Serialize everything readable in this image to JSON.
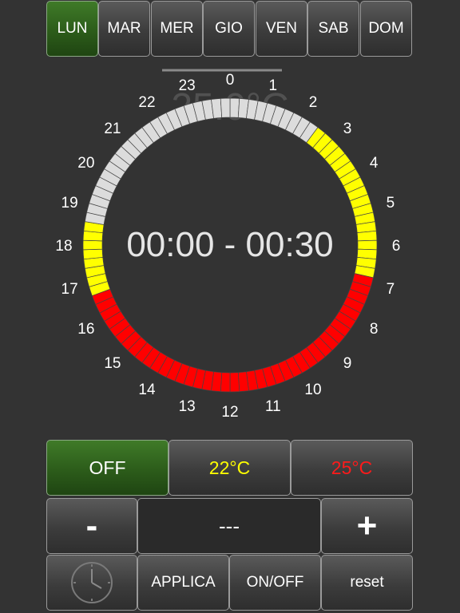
{
  "days": [
    {
      "label": "LUN",
      "active": true
    },
    {
      "label": "MAR",
      "active": false
    },
    {
      "label": "MER",
      "active": false
    },
    {
      "label": "GIO",
      "active": false
    },
    {
      "label": "VEN",
      "active": false
    },
    {
      "label": "SAB",
      "active": false
    },
    {
      "label": "DOM",
      "active": false
    }
  ],
  "dial": {
    "time_range": "00:00 - 00:30",
    "ghost_temp": "25.0°C",
    "hour_labels": [
      "0",
      "1",
      "2",
      "3",
      "4",
      "5",
      "6",
      "7",
      "8",
      "9",
      "10",
      "11",
      "12",
      "13",
      "14",
      "15",
      "16",
      "17",
      "18",
      "19",
      "20",
      "21",
      "22",
      "23"
    ],
    "segments": [
      "gray",
      "gray",
      "gray",
      "gray",
      "gray",
      "gray",
      "gray",
      "gray",
      "gray",
      "gray",
      "yellow",
      "yellow",
      "yellow",
      "yellow",
      "yellow",
      "yellow",
      "yellow",
      "yellow",
      "yellow",
      "yellow",
      "yellow",
      "yellow",
      "yellow",
      "yellow",
      "yellow",
      "yellow",
      "yellow",
      "yellow",
      "red",
      "red",
      "red",
      "red",
      "red",
      "red",
      "red",
      "red",
      "red",
      "red",
      "red",
      "red",
      "red",
      "red",
      "red",
      "red",
      "red",
      "red",
      "red",
      "red",
      "red",
      "red",
      "red",
      "red",
      "red",
      "red",
      "red",
      "red",
      "red",
      "red",
      "red",
      "red",
      "red",
      "red",
      "red",
      "red",
      "red",
      "red",
      "red",
      "red",
      "yellow",
      "yellow",
      "yellow",
      "yellow",
      "yellow",
      "yellow",
      "yellow",
      "yellow",
      "gray",
      "gray",
      "gray",
      "gray",
      "gray",
      "gray",
      "gray",
      "gray",
      "gray",
      "gray",
      "gray",
      "gray",
      "gray",
      "gray",
      "gray",
      "gray",
      "gray",
      "gray",
      "gray",
      "gray",
      "gray",
      "gray"
    ]
  },
  "colors": {
    "off": "#888888",
    "gray": "#dcdcdc",
    "yellow": "#ffff00",
    "red": "#ff0000",
    "temp_low": "#ffff00",
    "temp_high": "#ff1a1a",
    "background": "#333333",
    "active_green": "#2c5c1a"
  },
  "modes": {
    "off_label": "OFF",
    "low_label": "22°C",
    "high_label": "25°C"
  },
  "controls": {
    "minus_label": "-",
    "value_display": "---",
    "plus_label": "+",
    "clock_icon": "clock-icon",
    "apply_label": "APPLICA",
    "onoff_label": "ON/OFF",
    "reset_label": "reset"
  }
}
